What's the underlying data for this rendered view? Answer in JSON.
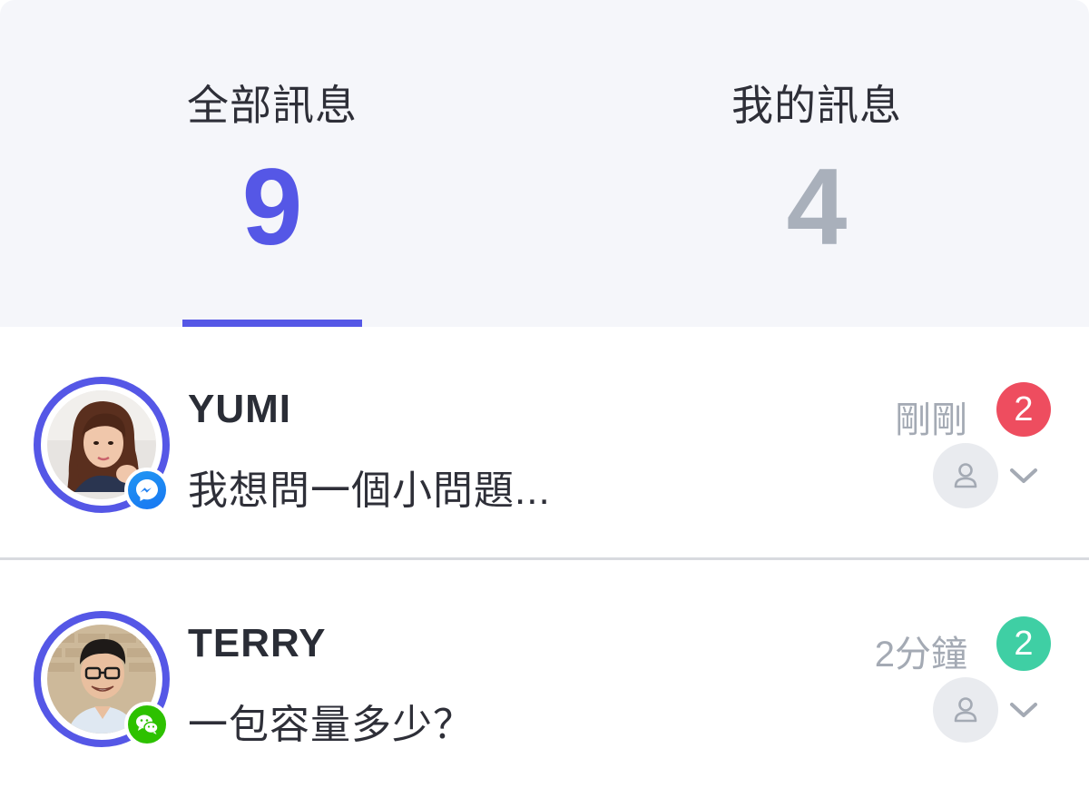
{
  "tabs": {
    "all": {
      "label": "全部訊息",
      "count": "9"
    },
    "mine": {
      "label": "我的訊息",
      "count": "4"
    }
  },
  "conversations": [
    {
      "name": "YUMI",
      "preview": "我想問一個小問題...",
      "time": "剛剛",
      "unread": "2",
      "channel_icon": "messenger-icon",
      "unread_color": "#ee4d5f"
    },
    {
      "name": "TERRY",
      "preview": "一包容量多少？",
      "time": "2分鐘",
      "unread": "2",
      "channel_icon": "wechat-icon",
      "unread_color": "#3fcfa4"
    }
  ],
  "colors": {
    "accent": "#5557e6",
    "muted": "#a9b0bb"
  }
}
